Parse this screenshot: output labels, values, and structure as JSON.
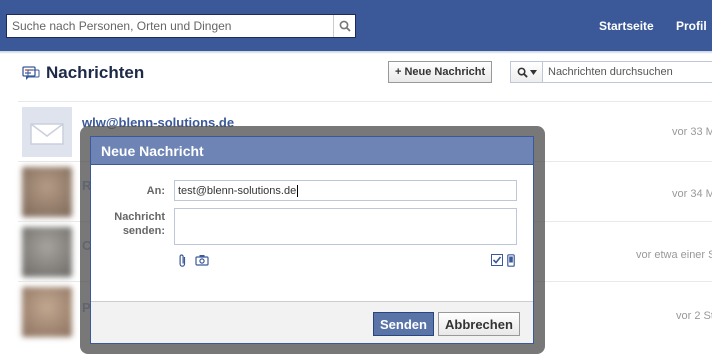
{
  "header": {
    "search_placeholder": "Suche nach Personen, Orten und Dingen",
    "nav": [
      "Startseite",
      "Profil"
    ]
  },
  "page": {
    "title": "Nachrichten",
    "new_message_button": "+ Neue Nachricht",
    "search_placeholder": "Nachrichten durchsuchen"
  },
  "threads": [
    {
      "sender": "wlw@blenn-solutions.de",
      "time": "vor 33 M"
    },
    {
      "initial": "R",
      "time": "vor 34 M"
    },
    {
      "initial": "C",
      "time": "vor etwa einer S"
    },
    {
      "initial": "P",
      "time": "vor 2 St"
    }
  ],
  "dialog": {
    "title": "Neue Nachricht",
    "to_label": "An:",
    "to_value": "test@blenn-solutions.de",
    "message_label_line1": "Nachricht",
    "message_label_line2": "senden:",
    "message_value": "",
    "send_label": "Senden",
    "cancel_label": "Abbrechen"
  },
  "colors": {
    "brand": "#3b5998",
    "dialog_header": "#6d84b4"
  }
}
